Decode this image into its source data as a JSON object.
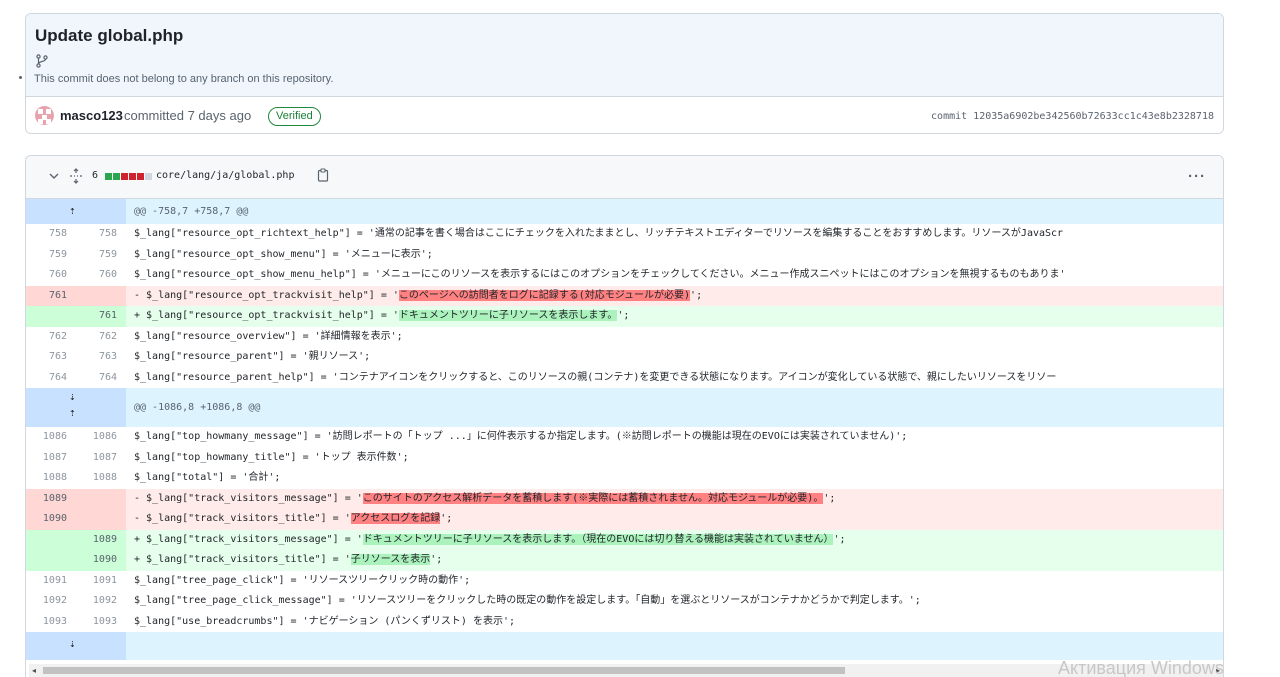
{
  "commit": {
    "title": "Update global.php",
    "branch_note": "This commit does not belong to any branch on this repository.",
    "author": "masco123",
    "committed_text": "committed 7 days ago",
    "verified_label": "Verified",
    "hash_text": "commit 12035a6902be342560b72633cc1c43e8b2328718"
  },
  "file": {
    "changes": "6",
    "diffstat": [
      "green",
      "green",
      "red",
      "red",
      "red",
      "gray"
    ],
    "path": "core/lang/ja/global.php",
    "more_label": "···"
  },
  "colors": {
    "add_bg": "#e6ffec",
    "del_bg": "#ffebe9",
    "hunk_bg": "#ddf4ff",
    "verified": "#1a7f37"
  },
  "diff": [
    {
      "type": "hunk",
      "text": "@@ -758,7 +758,7 @@",
      "icon": "expand-up"
    },
    {
      "type": "ctx",
      "old": "758",
      "new": "758",
      "code": "  $_lang[\"resource_opt_richtext_help\"] = '通常の記事を書く場合はここにチェックを入れたままとし、リッチテキストエディターでリソースを編集することをおすすめします。リソースがJavaScr"
    },
    {
      "type": "ctx",
      "old": "759",
      "new": "759",
      "code": "  $_lang[\"resource_opt_show_menu\"] = 'メニューに表示';"
    },
    {
      "type": "ctx",
      "old": "760",
      "new": "760",
      "code": "  $_lang[\"resource_opt_show_menu_help\"] = 'メニューにこのリソースを表示するにはこのオプションをチェックしてください。メニュー作成スニペットにはこのオプションを無視するものもありま'"
    },
    {
      "type": "del",
      "old": "761",
      "new": "",
      "pre": "- $_lang[\"resource_opt_trackvisit_help\"] = '",
      "hl": "このページへの訪問者をログに記録する(対応モジュールが必要)",
      "post": "';"
    },
    {
      "type": "add",
      "old": "",
      "new": "761",
      "pre": "+ $_lang[\"resource_opt_trackvisit_help\"] = '",
      "hl": "ドキュメントツリーに子リソースを表示します。",
      "post": "';"
    },
    {
      "type": "ctx",
      "old": "762",
      "new": "762",
      "code": "  $_lang[\"resource_overview\"] = '詳細情報を表示';"
    },
    {
      "type": "ctx",
      "old": "763",
      "new": "763",
      "code": "  $_lang[\"resource_parent\"] = '親リソース';"
    },
    {
      "type": "ctx",
      "old": "764",
      "new": "764",
      "code": "  $_lang[\"resource_parent_help\"] = 'コンテナアイコンをクリックすると、このリソースの親(コンテナ)を変更できる状態になります。アイコンが変化している状態で、親にしたいリソースをリソー"
    },
    {
      "type": "hunk",
      "text": "@@ -1086,8 +1086,8 @@",
      "icon": "expand-both"
    },
    {
      "type": "ctx",
      "old": "1086",
      "new": "1086",
      "code": "  $_lang[\"top_howmany_message\"] = '訪問レポートの「トップ ...」に何件表示するか指定します。(※訪問レポートの機能は現在のEVOには実装されていません)';"
    },
    {
      "type": "ctx",
      "old": "1087",
      "new": "1087",
      "code": "  $_lang[\"top_howmany_title\"] = 'トップ 表示件数';"
    },
    {
      "type": "ctx",
      "old": "1088",
      "new": "1088",
      "code": "  $_lang[\"total\"] = '合計';"
    },
    {
      "type": "del",
      "old": "1089",
      "new": "",
      "pre": "- $_lang[\"track_visitors_message\"] = '",
      "hl": "このサイトのアクセス解析データを蓄積します(※実際には蓄積されません。対応モジュールが必要)。",
      "post": "';"
    },
    {
      "type": "del",
      "old": "1090",
      "new": "",
      "pre": "- $_lang[\"track_visitors_title\"] = '",
      "hl": "アクセスログを記録",
      "post": "';"
    },
    {
      "type": "add",
      "old": "",
      "new": "1089",
      "pre": "+ $_lang[\"track_visitors_message\"] = '",
      "hl": "ドキュメントツリーに子リソースを表示します。（現在のEVOには切り替える機能は実装されていません）",
      "post": "';"
    },
    {
      "type": "add",
      "old": "",
      "new": "1090",
      "pre": "+ $_lang[\"track_visitors_title\"] = '",
      "hl": "子リソースを表示",
      "post": "';"
    },
    {
      "type": "ctx",
      "old": "1091",
      "new": "1091",
      "code": "  $_lang[\"tree_page_click\"] = 'リソースツリークリック時の動作';"
    },
    {
      "type": "ctx",
      "old": "1092",
      "new": "1092",
      "code": "  $_lang[\"tree_page_click_message\"] = 'リソースツリーをクリックした時の既定の動作を設定します。「自動」を選ぶとリソースがコンテナかどうかで判定します。';"
    },
    {
      "type": "ctx",
      "old": "1093",
      "new": "1093",
      "code": "  $_lang[\"use_breadcrumbs\"] = 'ナビゲーション (パンくずリスト) を表示';"
    },
    {
      "type": "hunk",
      "text": "",
      "icon": "expand-down"
    }
  ],
  "watermark": "Активация Windows"
}
